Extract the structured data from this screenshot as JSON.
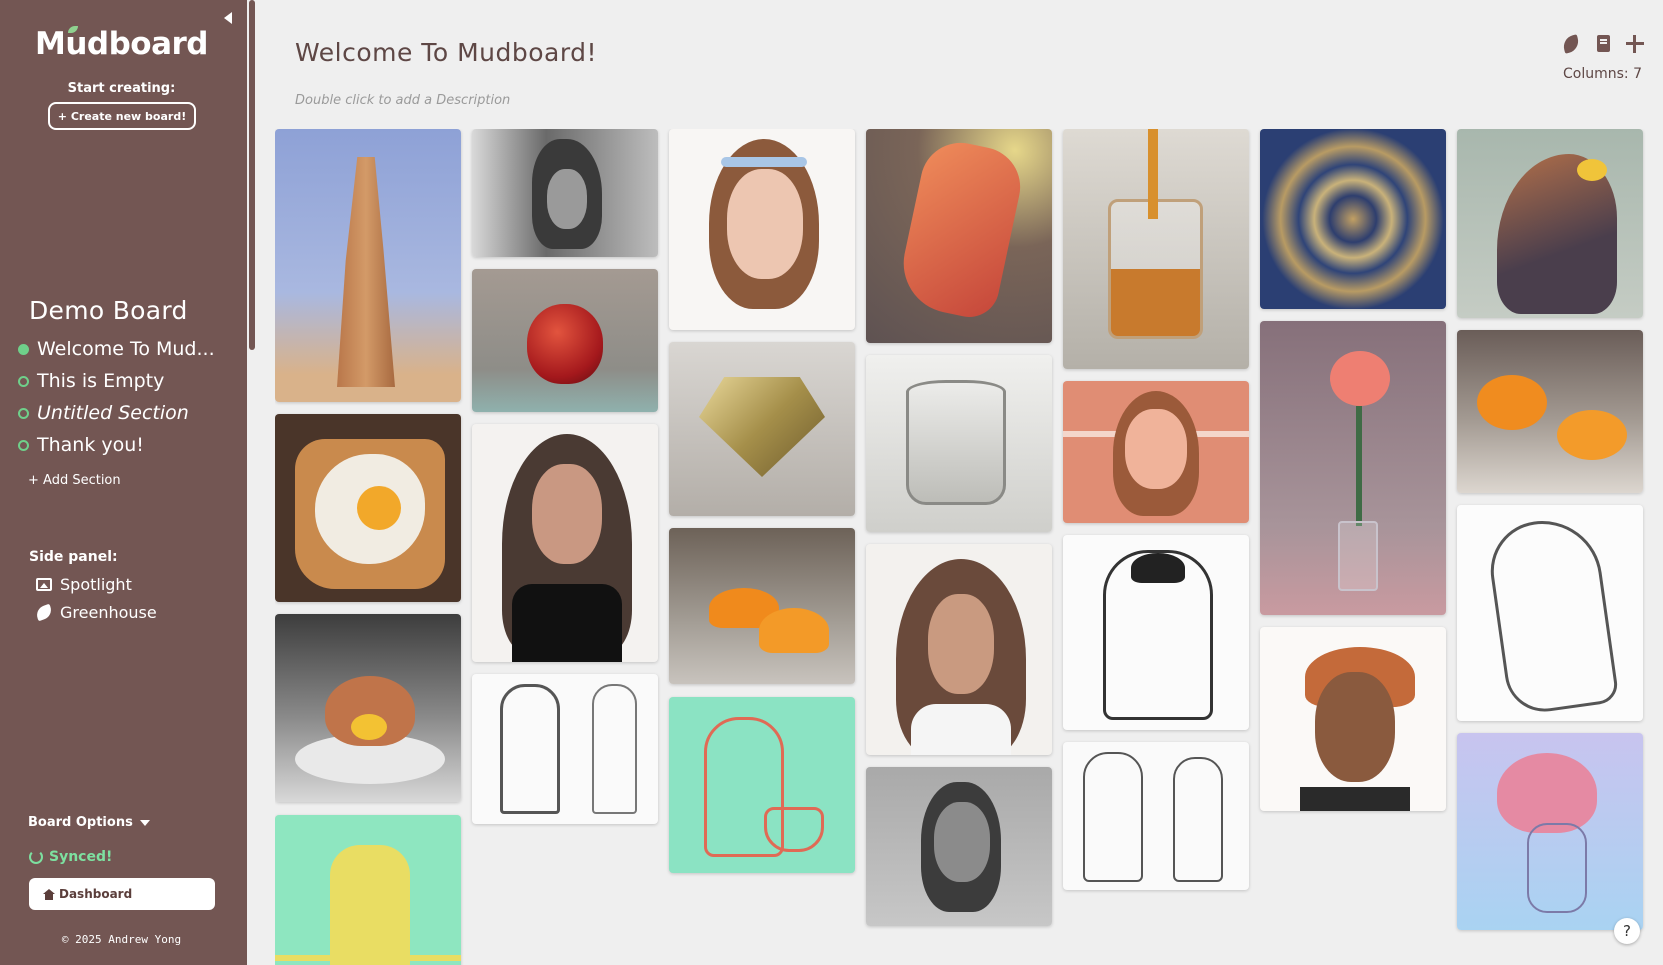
{
  "sidebar": {
    "logo": "Mudboard",
    "start_creating": "Start creating:",
    "create_board": "+ Create new board!",
    "board_title": "Demo Board",
    "sections": [
      {
        "label": "Welcome To Mud...",
        "active": true,
        "italic": false
      },
      {
        "label": "This is Empty",
        "active": false,
        "italic": false
      },
      {
        "label": "Untitled Section",
        "active": false,
        "italic": true
      },
      {
        "label": "Thank you!",
        "active": false,
        "italic": false
      }
    ],
    "add_section": "+ Add Section",
    "side_panel_label": "Side panel:",
    "panel_items": [
      {
        "label": "Spotlight",
        "icon": "image-icon"
      },
      {
        "label": "Greenhouse",
        "icon": "leaf-icon"
      }
    ],
    "board_options": "Board Options",
    "synced": "Synced!",
    "dashboard": "Dashboard",
    "copyright": "© 2025 Andrew Yong"
  },
  "header": {
    "title": "Welcome To Mudboard!",
    "description_placeholder": "Double click to add a Description",
    "columns_label": "Columns: 7",
    "tools": [
      "theme-icon",
      "file-icon",
      "add-icon"
    ]
  },
  "help": "?",
  "colors": {
    "sidebar": "#735653",
    "accent_green": "#6fd08a",
    "background": "#efefef",
    "title_text": "#5e4745"
  }
}
